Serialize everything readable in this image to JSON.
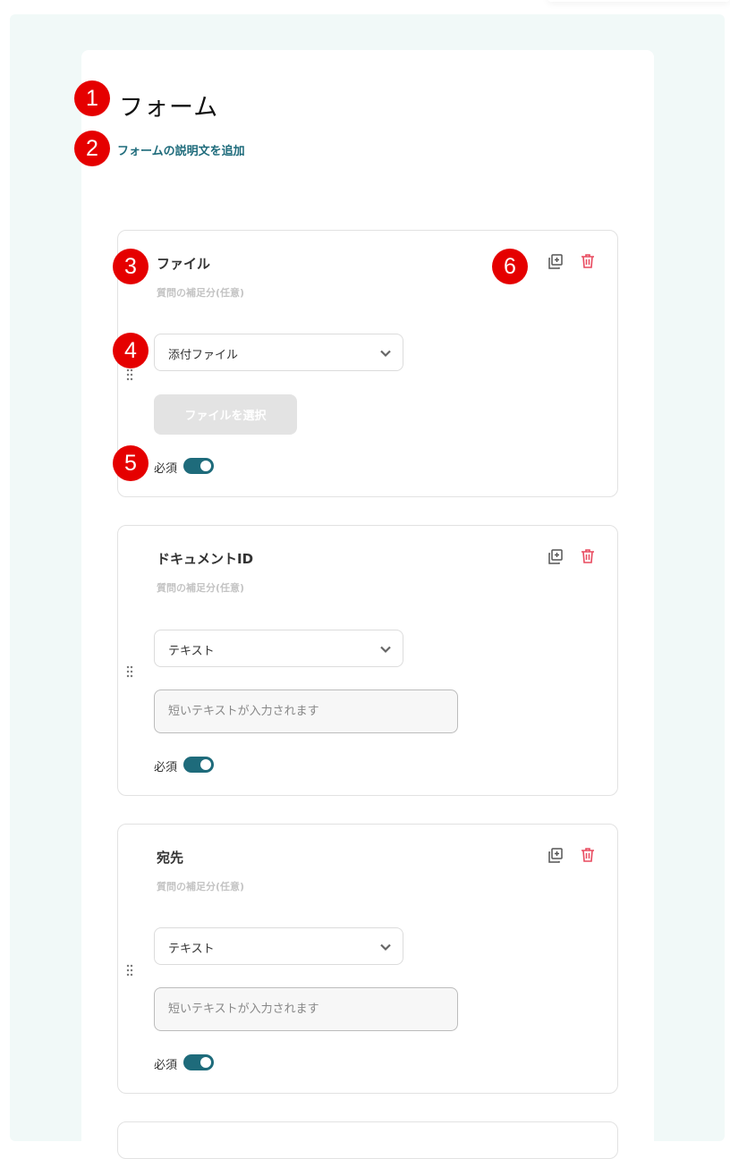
{
  "form": {
    "title": "フォーム",
    "description_link": "フォームの説明文を追加"
  },
  "questions": [
    {
      "title": "ファイル",
      "subtitle": "質問の補足分(任意)",
      "type": "添付ファイル",
      "file_button": "ファイルを選択",
      "required_label": "必須",
      "required": true
    },
    {
      "title": "ドキュメントID",
      "subtitle": "質問の補足分(任意)",
      "type": "テキスト",
      "input_placeholder": "短いテキストが入力されます",
      "required_label": "必須",
      "required": true
    },
    {
      "title": "宛先",
      "subtitle": "質問の補足分(任意)",
      "type": "テキスト",
      "input_placeholder": "短いテキストが入力されます",
      "required_label": "必須",
      "required": true
    }
  ],
  "markers": [
    "1",
    "2",
    "3",
    "4",
    "5",
    "6"
  ],
  "icons": {
    "copy": "copy-icon",
    "delete": "trash-icon",
    "drag": "drag-handle-icon",
    "dropdown": "chevron-down-icon"
  },
  "colors": {
    "accent": "#1e6b7b",
    "delete": "#e84a5f",
    "marker": "#e50000",
    "background": "#f1f9f8"
  }
}
